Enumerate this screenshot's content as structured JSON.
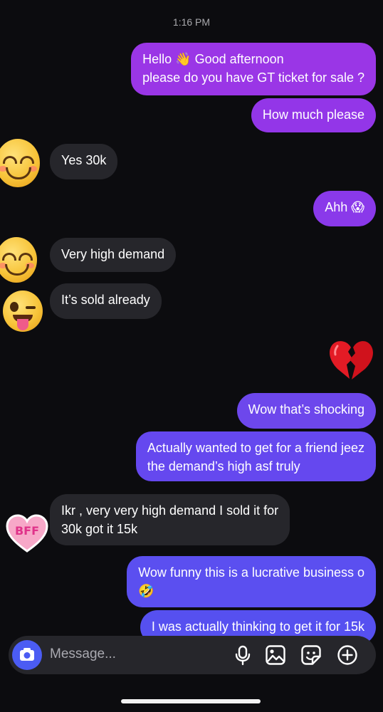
{
  "timestamp": "1:16 PM",
  "messages": [
    {
      "dir": "out",
      "lines": [
        "Hello 👋 Good afternoon",
        "please do you have GT ticket for sale ?"
      ]
    },
    {
      "dir": "out",
      "lines": [
        "How much please"
      ]
    },
    {
      "dir": "in",
      "lines": [
        "Yes 30k"
      ],
      "avatar": "smiling-face-icon"
    },
    {
      "dir": "out",
      "lines": [
        "Ahh 😱"
      ]
    },
    {
      "dir": "in",
      "lines": [
        "Very high demand"
      ],
      "avatar": "smiling-face-icon"
    },
    {
      "dir": "in",
      "lines": [
        "It’s sold already"
      ],
      "avatar": "winking-tongue-face-icon"
    },
    {
      "dir": "out",
      "lines": [
        "💔"
      ]
    },
    {
      "dir": "out",
      "lines": [
        "Wow that’s shocking"
      ]
    },
    {
      "dir": "out",
      "lines": [
        "Actually wanted to get for a friend jeez",
        "the demand’s high asf truly"
      ]
    },
    {
      "dir": "in",
      "lines": [
        "Ikr , very very high demand I sold it for",
        "30k got it 15k"
      ],
      "avatar": "bff-heart-sticker"
    },
    {
      "dir": "out",
      "lines": [
        "Wow funny this is a lucrative business o",
        "🤣"
      ]
    },
    {
      "dir": "out",
      "lines": [
        "I was actually thinking to get it for 15k"
      ]
    }
  ],
  "bff_label": "BFF",
  "composer": {
    "placeholder": "Message...",
    "icons": [
      "camera-icon",
      "microphone-icon",
      "gallery-icon",
      "sticker-icon",
      "add-icon"
    ]
  },
  "colors": {
    "background": "#0c0c0f",
    "incoming_bubble": "#26262b",
    "outgoing_top": "#9a36e6",
    "outgoing_bottom": "#5b4ff0",
    "camera_button": "#4b5cf3"
  }
}
